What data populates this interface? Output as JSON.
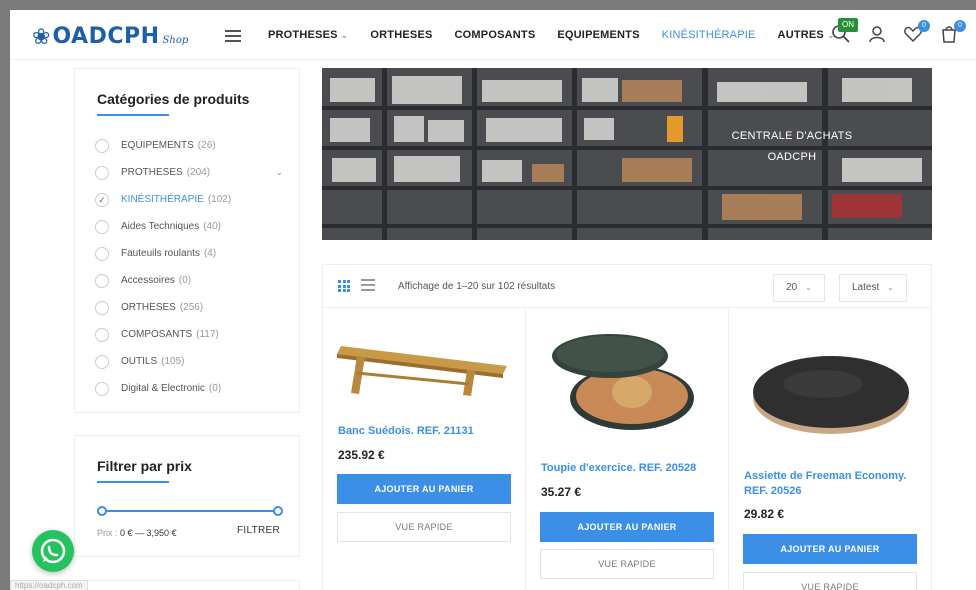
{
  "header": {
    "logo_text": "OADCPH",
    "logo_sub": "Shop",
    "nav": [
      {
        "label": "PROTHESES",
        "has_dropdown": true,
        "active": false
      },
      {
        "label": "ORTHESES",
        "has_dropdown": false,
        "active": false
      },
      {
        "label": "COMPOSANTS",
        "has_dropdown": false,
        "active": false
      },
      {
        "label": "EQUIPEMENTS",
        "has_dropdown": false,
        "active": false
      },
      {
        "label": "KINÉSITHÉRAPIE",
        "has_dropdown": false,
        "active": true
      },
      {
        "label": "AUTRES",
        "has_dropdown": true,
        "active": false
      }
    ],
    "on_badge": "ON",
    "wishlist_count": "0",
    "cart_count": "0",
    "icons": [
      "search-icon",
      "user-icon",
      "heart-icon",
      "cart-icon"
    ]
  },
  "sidebar": {
    "categories_title": "Catégories de produits",
    "categories": [
      {
        "label": "EQUIPEMENTS",
        "count": "(26)",
        "checked": false,
        "expandable": false
      },
      {
        "label": "PROTHESES",
        "count": "(204)",
        "checked": false,
        "expandable": true
      },
      {
        "label": "KINÉSITHÉRAPIE",
        "count": "(102)",
        "checked": true,
        "expandable": false
      },
      {
        "label": "Aides Techniques",
        "count": "(40)",
        "checked": false,
        "expandable": false
      },
      {
        "label": "Fauteuils roulants",
        "count": "(4)",
        "checked": false,
        "expandable": false
      },
      {
        "label": "Accessoires",
        "count": "(0)",
        "checked": false,
        "expandable": false
      },
      {
        "label": "ORTHESES",
        "count": "(256)",
        "checked": false,
        "expandable": false
      },
      {
        "label": "COMPOSANTS",
        "count": "(117)",
        "checked": false,
        "expandable": false
      },
      {
        "label": "OUTILS",
        "count": "(105)",
        "checked": false,
        "expandable": false
      },
      {
        "label": "Digital & Electronic",
        "count": "(0)",
        "checked": false,
        "expandable": false
      }
    ],
    "price_title": "Filtrer par prix",
    "price_prefix": "Prix :",
    "price_range": "0 € — 3,950 €",
    "filter_label": "FILTRER"
  },
  "banner": {
    "line1": "CENTRALE D'ACHATS",
    "line2": "OADCPH"
  },
  "toolbar": {
    "result_text": "Affichage de 1–20 sur 102 résultats",
    "per_page": "20",
    "sort": "Latest"
  },
  "products": [
    {
      "name": "Banc Suédois. REF. 21131",
      "price": "235.92 €",
      "add_label": "AJOUTER AU PANIER",
      "quick_label": "VUE RAPIDE"
    },
    {
      "name": "Toupie d'exercice. REF. 20528",
      "price": "35.27 €",
      "add_label": "AJOUTER AU PANIER",
      "quick_label": "VUE RAPIDE"
    },
    {
      "name": "Assiette de Freeman Economy. REF. 20526",
      "price": "29.82 €",
      "add_label": "AJOUTER AU PANIER",
      "quick_label": "VUE RAPIDE"
    }
  ],
  "status_url": "https://oadcph.com",
  "colors": {
    "accent": "#3b8fe6",
    "brand": "#1d5fa8",
    "whatsapp": "#25c25f"
  }
}
